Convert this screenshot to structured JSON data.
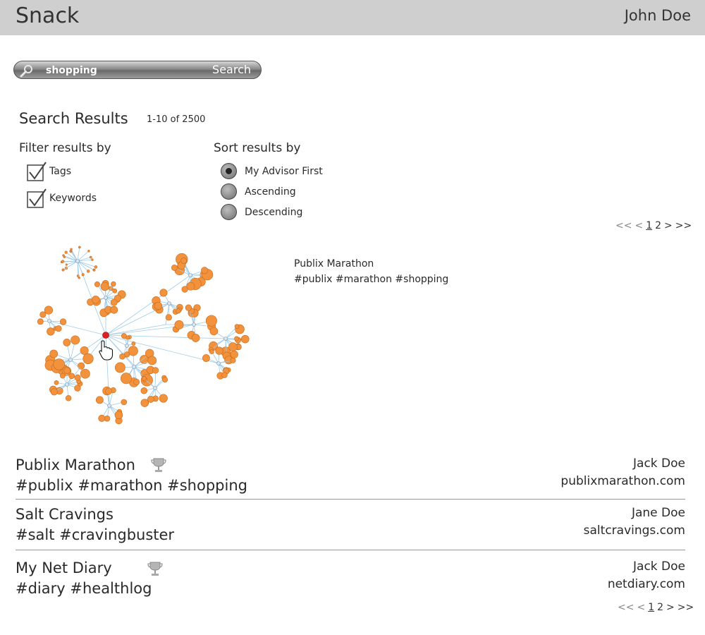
{
  "app": {
    "title": "Snack",
    "user": "John Doe"
  },
  "search": {
    "value": "shopping",
    "button_label": "Search"
  },
  "results": {
    "title": "Search Results",
    "count": "1-10 of 2500"
  },
  "filter": {
    "title": "Filter results by",
    "options": [
      {
        "label": "Tags",
        "checked": true
      },
      {
        "label": "Keywords",
        "checked": true
      }
    ]
  },
  "sort": {
    "title": "Sort results by",
    "options": [
      {
        "label": "My Advisor First",
        "selected": true
      },
      {
        "label": "Ascending",
        "selected": false
      },
      {
        "label": "Descending",
        "selected": false
      }
    ]
  },
  "pager": {
    "first": "<<",
    "prev": "<",
    "page1": "1",
    "page2": "2",
    "next": ">",
    "last": ">>",
    "current": 1
  },
  "graph": {
    "hover_title": "Publix Marathon",
    "hover_tags": "#publix #marathon #shopping"
  },
  "items": [
    {
      "title": "Publix Marathon",
      "tags": "#publix #marathon #shopping",
      "author": "Jack Doe",
      "site": "publixmarathon.com",
      "trophy": true
    },
    {
      "title": "Salt Cravings",
      "tags": "#salt #cravingbuster",
      "author": "Jane Doe",
      "site": "saltcravings.com",
      "trophy": false
    },
    {
      "title": "My Net Diary",
      "tags": "#diary #healthlog",
      "author": "Jack Doe",
      "site": "netdiary.com",
      "trophy": true
    }
  ],
  "colors": {
    "header_bg": "#cfcfcf",
    "leaf_node": "#f2923c",
    "root_node": "#e02020",
    "edge": "#9fcbe6"
  },
  "icons": {
    "search": "search-icon",
    "trophy": "trophy-icon",
    "cursor": "hand-cursor-icon"
  }
}
